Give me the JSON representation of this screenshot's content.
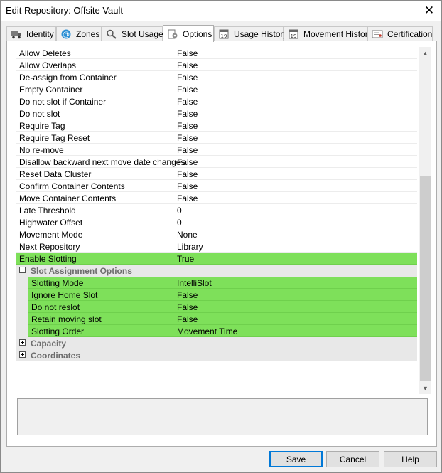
{
  "window": {
    "title": "Edit Repository: Offsite Vault",
    "close_glyph": "✕"
  },
  "tabs": [
    {
      "label": "Identity",
      "icon": "truck-icon"
    },
    {
      "label": "Zones",
      "icon": "at-sign-icon"
    },
    {
      "label": "Slot Usage",
      "icon": "magnifier-icon"
    },
    {
      "label": "Options",
      "icon": "options-icon",
      "active": true
    },
    {
      "label": "Usage History",
      "icon": "calendar-icon"
    },
    {
      "label": "Movement History",
      "icon": "calendar-icon"
    },
    {
      "label": "Certification",
      "icon": "certificate-icon"
    }
  ],
  "properties": [
    {
      "name": "Allow Deletes",
      "value": "False"
    },
    {
      "name": "Allow Overlaps",
      "value": "False"
    },
    {
      "name": "De-assign from Container",
      "value": "False"
    },
    {
      "name": "Empty Container",
      "value": "False"
    },
    {
      "name": "Do not slot if Container",
      "value": "False"
    },
    {
      "name": "Do not slot",
      "value": "False"
    },
    {
      "name": "Require Tag",
      "value": "False"
    },
    {
      "name": "Require Tag Reset",
      "value": "False"
    },
    {
      "name": "No re-move",
      "value": "False"
    },
    {
      "name": "Disallow backward next move date changes",
      "value": "False"
    },
    {
      "name": "Reset Data Cluster",
      "value": "False"
    },
    {
      "name": "Confirm Container Contents",
      "value": "False"
    },
    {
      "name": "Move Container Contents",
      "value": "False"
    },
    {
      "name": "Late Threshold",
      "value": "0"
    },
    {
      "name": "Highwater Offset",
      "value": "0"
    },
    {
      "name": "Movement Mode",
      "value": "None"
    },
    {
      "name": "Next Repository",
      "value": "Library"
    },
    {
      "name": "Enable Slotting",
      "value": "True",
      "highlight": true
    }
  ],
  "slot_assignment": {
    "label": "Slot Assignment Options",
    "expanded": true,
    "items": [
      {
        "name": "Slotting Mode",
        "value": "IntelliSlot"
      },
      {
        "name": "Ignore Home Slot",
        "value": "False"
      },
      {
        "name": "Do not reslot",
        "value": "False"
      },
      {
        "name": "Retain moving slot",
        "value": "False"
      },
      {
        "name": "Slotting Order",
        "value": "Movement Time"
      }
    ]
  },
  "collapsed_categories": [
    {
      "label": "Capacity"
    },
    {
      "label": "Coordinates"
    }
  ],
  "description": "",
  "buttons": {
    "save": "Save",
    "cancel": "Cancel",
    "help": "Help"
  },
  "colors": {
    "highlight": "#7ee05a",
    "default_button_border": "#0078d7"
  }
}
